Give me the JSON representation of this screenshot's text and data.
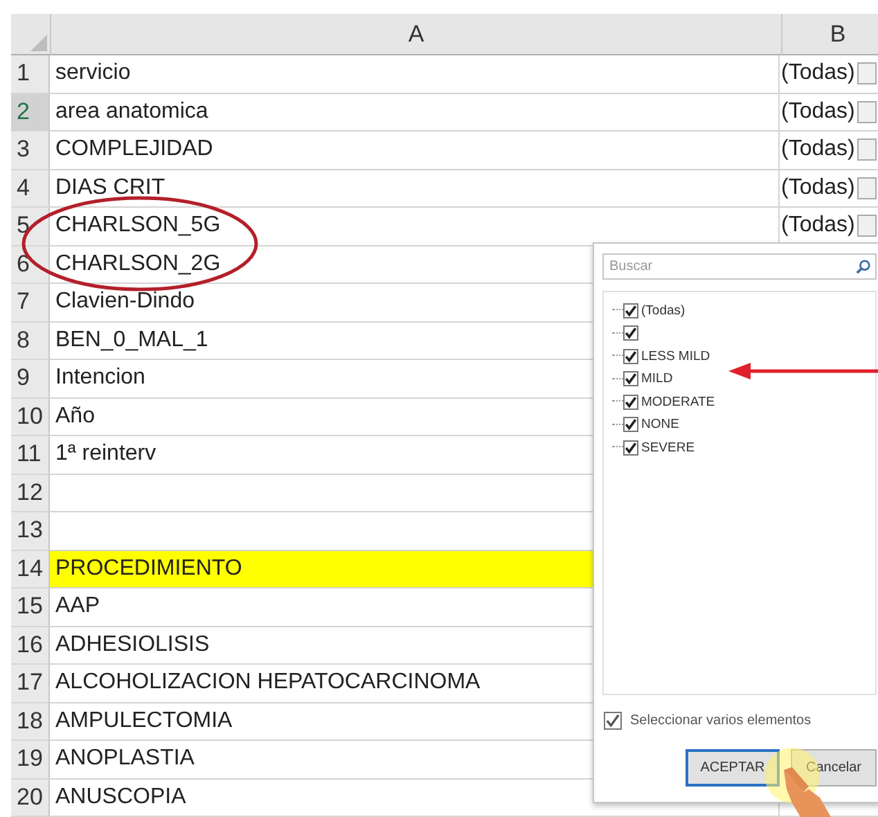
{
  "sheet": {
    "columns": [
      "A",
      "B"
    ],
    "rows": [
      {
        "number": "1",
        "a": "servicio",
        "b": "(Todas)",
        "selected": false,
        "highlighted": false
      },
      {
        "number": "2",
        "a": "area anatomica",
        "b": "(Todas)",
        "selected": true,
        "highlighted": false
      },
      {
        "number": "3",
        "a": "COMPLEJIDAD",
        "b": "(Todas)",
        "selected": false,
        "highlighted": false
      },
      {
        "number": "4",
        "a": "DIAS CRIT",
        "b": "(Todas)",
        "selected": false,
        "highlighted": false
      },
      {
        "number": "5",
        "a": "CHARLSON_5G",
        "b": "(Todas)",
        "selected": false,
        "highlighted": false
      },
      {
        "number": "6",
        "a": "CHARLSON_2G",
        "selected": false,
        "highlighted": false
      },
      {
        "number": "7",
        "a": "Clavien-Dindo",
        "selected": false,
        "highlighted": false
      },
      {
        "number": "8",
        "a": "BEN_0_MAL_1",
        "selected": false,
        "highlighted": false
      },
      {
        "number": "9",
        "a": "Intencion",
        "selected": false,
        "highlighted": false
      },
      {
        "number": "10",
        "a": "Año",
        "selected": false,
        "highlighted": false
      },
      {
        "number": "11",
        "a": "1ª reinterv",
        "selected": false,
        "highlighted": false
      },
      {
        "number": "12",
        "selected": false,
        "highlighted": false
      },
      {
        "number": "13",
        "selected": false,
        "highlighted": false
      },
      {
        "number": "14",
        "a": "PROCEDIMIENTO",
        "selected": false,
        "highlighted": true
      },
      {
        "number": "15",
        "a": "AAP",
        "selected": false,
        "highlighted": false
      },
      {
        "number": "16",
        "a": "ADHESIOLISIS",
        "selected": false,
        "highlighted": false
      },
      {
        "number": "17",
        "a": "ALCOHOLIZACION HEPATOCARCINOMA",
        "selected": false,
        "highlighted": false
      },
      {
        "number": "18",
        "a": "AMPULECTOMIA",
        "selected": false,
        "highlighted": false
      },
      {
        "number": "19",
        "a": "ANOPLASTIA",
        "selected": false,
        "highlighted": false
      },
      {
        "number": "20",
        "a": "ANUSCOPIA",
        "selected": false,
        "highlighted": false
      }
    ]
  },
  "filter_popup": {
    "search": {
      "placeholder": "Buscar"
    },
    "items": [
      {
        "label": "(Todas)",
        "checked": true
      },
      {
        "checked": true
      },
      {
        "label": "LESS MILD",
        "checked": true
      },
      {
        "label": "MILD",
        "checked": true
      },
      {
        "label": "MODERATE",
        "checked": true
      },
      {
        "label": "NONE",
        "checked": true
      },
      {
        "label": "SEVERE",
        "checked": true
      }
    ],
    "multi_select": {
      "label": "Seleccionar varios elementos",
      "checked": true
    },
    "buttons": [
      {
        "label": "ACEPTAR",
        "kind": "primary"
      },
      {
        "label": "Cancelar",
        "kind": "secondary"
      }
    ]
  }
}
